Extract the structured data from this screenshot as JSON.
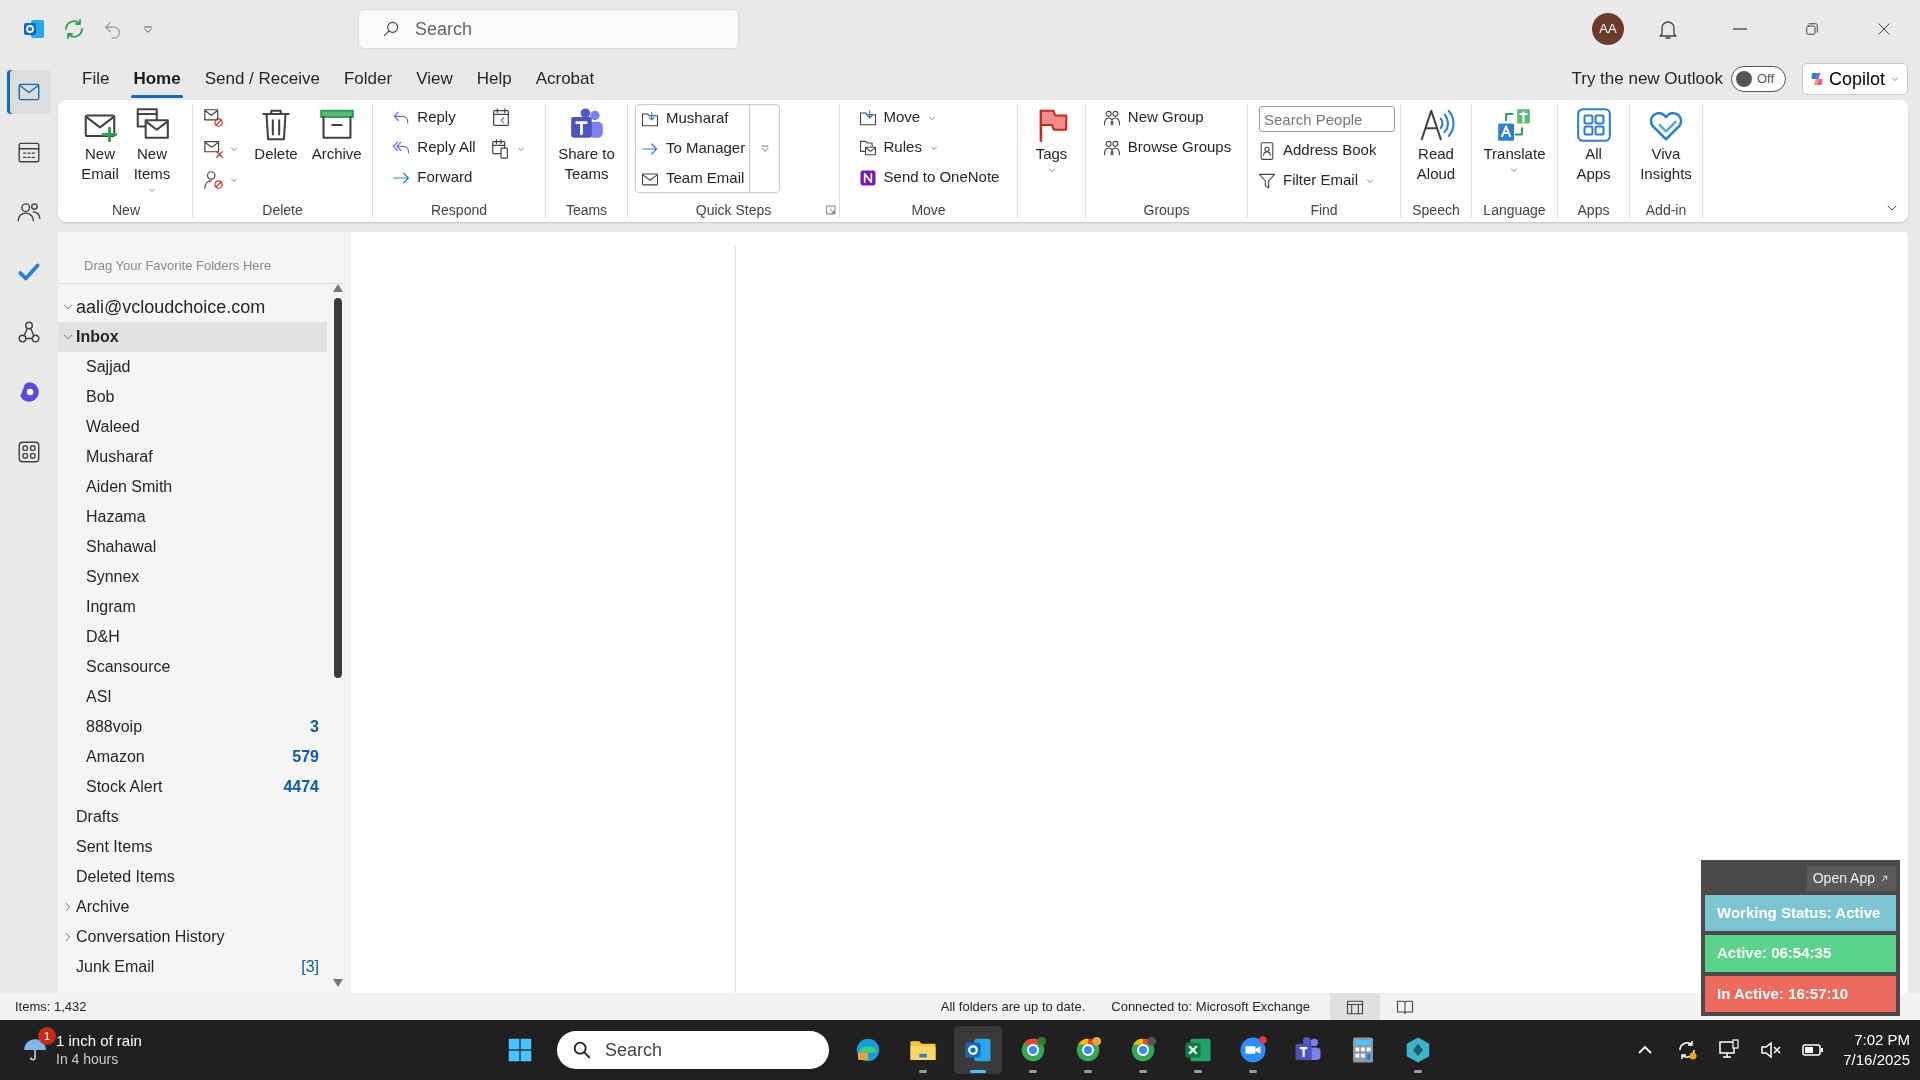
{
  "title_bar": {
    "search": {
      "placeholder": "Search"
    },
    "avatar": "AA"
  },
  "app_rail": [
    {
      "selected": true
    },
    {
      "selected": false
    },
    {
      "selected": false
    },
    {
      "selected": false
    },
    {
      "selected": false
    },
    {
      "selected": false
    },
    {
      "selected": false
    }
  ],
  "menu_tabs": [
    {
      "label": "File",
      "selected": false
    },
    {
      "label": "Home",
      "selected": true
    },
    {
      "label": "Send / Receive",
      "selected": false
    },
    {
      "label": "Folder",
      "selected": false
    },
    {
      "label": "View",
      "selected": false
    },
    {
      "label": "Help",
      "selected": false
    },
    {
      "label": "Acrobat",
      "selected": false
    }
  ],
  "new_outlook": {
    "label": "Try the new Outlook",
    "toggle": {
      "on": false,
      "text": "Off"
    },
    "copilot": "Copilot"
  },
  "ribbon": [
    {
      "name": "New",
      "columns": [
        [
          {
            "kind": "large",
            "label": "New\nEmail"
          }
        ],
        [
          {
            "kind": "large",
            "label": "New\nItems",
            "dropdown": true
          }
        ]
      ]
    },
    {
      "name": "Delete",
      "columns": [
        [
          {
            "kind": "icon"
          },
          {
            "kind": "icon",
            "dropdown": true
          },
          {
            "kind": "icon",
            "dropdown": true
          }
        ],
        [
          {
            "kind": "large",
            "label": "Delete"
          }
        ],
        [
          {
            "kind": "large",
            "label": "Archive"
          }
        ]
      ]
    },
    {
      "name": "Respond",
      "columns": [
        [
          {
            "kind": "small",
            "label": "Reply"
          },
          {
            "kind": "small",
            "label": "Reply All"
          },
          {
            "kind": "small",
            "label": "Forward"
          }
        ],
        [
          {
            "kind": "icon"
          },
          {
            "kind": "icon",
            "dropdown": true
          }
        ]
      ]
    },
    {
      "name": "Teams",
      "columns": [
        [
          {
            "kind": "large",
            "label": "Share to\nTeams"
          }
        ]
      ]
    },
    {
      "name": "Quick Steps",
      "gallery": true,
      "launcher": true,
      "columns": [
        [
          {
            "kind": "small",
            "label": "Musharaf"
          },
          {
            "kind": "small",
            "label": "To Manager"
          },
          {
            "kind": "small",
            "label": "Team Email"
          }
        ]
      ]
    },
    {
      "name": "Move",
      "columns": [
        [
          {
            "kind": "small",
            "label": "Move",
            "dropdown": true
          },
          {
            "kind": "small",
            "label": "Rules",
            "dropdown": true
          },
          {
            "kind": "small",
            "label": "Send to OneNote"
          }
        ]
      ]
    },
    {
      "columns": [
        [
          {
            "kind": "large",
            "label": "Tags",
            "dropdown": true
          }
        ]
      ]
    },
    {
      "name": "Groups",
      "columns": [
        [
          {
            "kind": "small",
            "label": "New Group"
          },
          {
            "kind": "small",
            "label": "Browse Groups"
          }
        ]
      ]
    },
    {
      "name": "Find",
      "columns": [
        [
          {
            "kind": "field",
            "placeholder": "Search People"
          },
          {
            "kind": "small",
            "label": "Address Book"
          },
          {
            "kind": "small",
            "label": "Filter Email",
            "dropdown": true
          }
        ]
      ]
    },
    {
      "name": "Speech",
      "columns": [
        [
          {
            "kind": "large",
            "label": "Read\nAloud"
          }
        ]
      ]
    },
    {
      "name": "Language",
      "columns": [
        [
          {
            "kind": "large",
            "label": "Translate",
            "dropdown": true
          }
        ]
      ]
    },
    {
      "name": "Apps",
      "columns": [
        [
          {
            "kind": "large",
            "label": "All\nApps"
          }
        ]
      ]
    },
    {
      "name": "Add-in",
      "columns": [
        [
          {
            "kind": "large",
            "label": "Viva\nInsights"
          }
        ]
      ]
    }
  ],
  "folder_pane": {
    "hint": "Drag Your Favorite Folders Here",
    "account": {
      "name": "aali@vcloudchoice.com",
      "expanded": true
    },
    "folders": [
      {
        "name": "Inbox",
        "expanded": true,
        "selected": true,
        "children": [
          {
            "name": "Sajjad",
            "selected": false
          },
          {
            "name": "Bob",
            "selected": false
          },
          {
            "name": "Waleed",
            "selected": false
          },
          {
            "name": "Musharaf",
            "selected": false
          },
          {
            "name": "Aiden Smith",
            "selected": false
          },
          {
            "name": "Hazama",
            "selected": false
          },
          {
            "name": "Shahawal",
            "selected": false
          },
          {
            "name": "Synnex",
            "selected": false
          },
          {
            "name": "Ingram",
            "selected": false
          },
          {
            "name": "D&H",
            "selected": false
          },
          {
            "name": "Scansource",
            "selected": false
          },
          {
            "name": "ASI",
            "selected": false
          },
          {
            "name": "888voip",
            "selected": false,
            "count": "3",
            "unread": true
          },
          {
            "name": "Amazon",
            "selected": false,
            "count": "579",
            "unread": true
          },
          {
            "name": "Stock Alert",
            "selected": false,
            "count": "4474",
            "unread": true
          }
        ]
      },
      {
        "name": "Drafts",
        "selected": false
      },
      {
        "name": "Sent Items",
        "selected": false
      },
      {
        "name": "Deleted Items",
        "selected": false
      },
      {
        "name": "Archive",
        "expanded": false,
        "selected": false
      },
      {
        "name": "Conversation History",
        "expanded": false,
        "selected": false
      },
      {
        "name": "Junk Email",
        "selected": false,
        "count": "[3]",
        "unread": false
      }
    ]
  },
  "status_bar": {
    "items": "Items: 1,432",
    "sync": "All folders are up to date.",
    "connection": "Connected to: Microsoft Exchange",
    "views": [
      {
        "selected": true
      },
      {
        "selected": false
      }
    ]
  },
  "tracker_widget": {
    "button": "Open App",
    "rows": [
      {
        "text": "Working Status: Active",
        "color": "#7cc4d2"
      },
      {
        "text": "Active: 06:54:35",
        "color": "#5cd38a"
      },
      {
        "text": "In Active: 16:57:10",
        "color": "#ec6b5e"
      }
    ]
  },
  "taskbar": {
    "weather": {
      "badge": "1",
      "title": "1 inch of rain",
      "subtitle": "In 4 hours"
    },
    "search": {
      "placeholder": "Search"
    },
    "apps": [
      {
        "running": false,
        "selected": false
      },
      {
        "running": false,
        "selected": false
      },
      {
        "running": true,
        "selected": false
      },
      {
        "running": true,
        "selected": true
      },
      {
        "running": true,
        "selected": false
      },
      {
        "running": true,
        "selected": false
      },
      {
        "running": true,
        "selected": false
      },
      {
        "running": true,
        "selected": false
      },
      {
        "running": true,
        "selected": false
      },
      {
        "running": false,
        "selected": false
      },
      {
        "running": false,
        "selected": false
      },
      {
        "running": true,
        "selected": false
      }
    ],
    "clock": {
      "time": "7:02 PM",
      "date": "7/16/2025"
    }
  }
}
